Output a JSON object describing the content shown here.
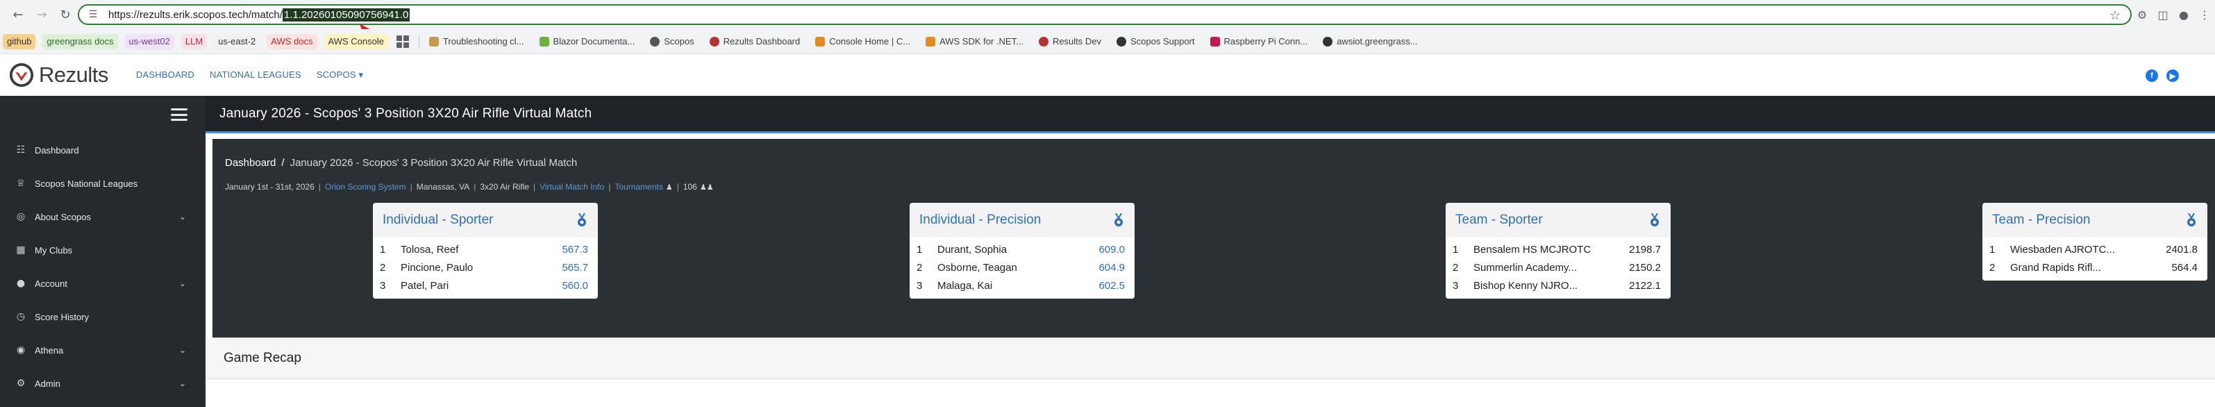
{
  "browser": {
    "url_prefix": "https://rezults.erik.scopos.tech/match/",
    "url_selected": "1.1.20260105090756941.0"
  },
  "bookmarks": {
    "chips": [
      {
        "label": "github",
        "bg": "#f6d18b",
        "fg": "#333333"
      },
      {
        "label": "greengrass docs",
        "bg": "#dff0d8",
        "fg": "#2e6b2e"
      },
      {
        "label": "us-west02",
        "bg": "#efe3f7",
        "fg": "#7a3aa0"
      },
      {
        "label": "LLM",
        "bg": "#fbe1e6",
        "fg": "#b0294a"
      },
      {
        "label": "us-east-2",
        "bg": "#f1f1f1",
        "fg": "#333333"
      },
      {
        "label": "AWS docs",
        "bg": "#fde2e2",
        "fg": "#c62828"
      },
      {
        "label": "AWS Console",
        "bg": "#fff3c4",
        "fg": "#333333"
      }
    ],
    "links": [
      {
        "label": "Troubleshooting cl...",
        "color": "#c79a54"
      },
      {
        "label": "Blazor Documenta...",
        "color": "#6cb33e"
      },
      {
        "label": "Scopos",
        "color": "#555555"
      },
      {
        "label": "Rezults Dashboard",
        "color": "#b5322f"
      },
      {
        "label": "Console Home | C...",
        "color": "#e48b1e"
      },
      {
        "label": "AWS SDK for .NET...",
        "color": "#e48b1e"
      },
      {
        "label": "Results Dev",
        "color": "#b5322f"
      },
      {
        "label": "Scopos Support",
        "color": "#333333"
      },
      {
        "label": "Raspberry Pi Conn...",
        "color": "#c51a4a"
      },
      {
        "label": "awsiot.greengrass...",
        "color": "#333333"
      }
    ]
  },
  "header": {
    "logo_text": "Rezults",
    "nav": [
      "DASHBOARD",
      "NATIONAL LEAGUES",
      "SCOPOS ▾"
    ]
  },
  "sidebar": {
    "items": [
      {
        "label": "Dashboard",
        "icon": "grid-icon",
        "glyph": "☷",
        "chevron": false
      },
      {
        "label": "Scopos National Leagues",
        "icon": "trophy-icon",
        "glyph": "♕",
        "chevron": false
      },
      {
        "label": "About Scopos",
        "icon": "target-icon",
        "glyph": "◎",
        "chevron": true
      },
      {
        "label": "My Clubs",
        "icon": "building-icon",
        "glyph": "▦",
        "chevron": false
      },
      {
        "label": "Account",
        "icon": "user-icon",
        "glyph": "●",
        "chevron": true
      },
      {
        "label": "Score History",
        "icon": "history-icon",
        "glyph": "◷",
        "chevron": false
      },
      {
        "label": "Athena",
        "icon": "athena-icon",
        "glyph": "◉",
        "chevron": true
      },
      {
        "label": "Admin",
        "icon": "gear-icon",
        "glyph": "⚙",
        "chevron": true
      }
    ]
  },
  "page": {
    "title": "January 2026 - Scopos' 3 Position 3X20 Air Rifle Virtual Match",
    "breadcrumb_root": "Dashboard",
    "breadcrumb_separator": "/",
    "breadcrumb_current": "January 2026 - Scopos' 3 Position 3X20 Air Rifle Virtual Match",
    "meta": {
      "dates": "January 1st - 31st, 2026",
      "scoring_system": "Orion Scoring System",
      "location": "Manassas, VA",
      "discipline": "3x20 Air Rifle",
      "virtual_info": "Virtual Match Info",
      "tournaments": "Tournaments",
      "participants": "106"
    }
  },
  "cards": [
    {
      "title": "Individual - Sporter",
      "rows": [
        {
          "rank": "1",
          "name": "Tolosa, Reef",
          "score": "567.3"
        },
        {
          "rank": "2",
          "name": "Pincione, Paulo",
          "score": "565.7"
        },
        {
          "rank": "3",
          "name": "Patel, Pari",
          "score": "560.0"
        }
      ]
    },
    {
      "title": "Individual - Precision",
      "rows": [
        {
          "rank": "1",
          "name": "Durant, Sophia",
          "score": "609.0"
        },
        {
          "rank": "2",
          "name": "Osborne, Teagan",
          "score": "604.9"
        },
        {
          "rank": "3",
          "name": "Malaga, Kai",
          "score": "602.5"
        }
      ]
    },
    {
      "title": "Team - Sporter",
      "rows": [
        {
          "rank": "1",
          "name": "Bensalem HS MCJROTC",
          "score": "2198.7"
        },
        {
          "rank": "2",
          "name": "Summerlin Academy...",
          "score": "2150.2"
        },
        {
          "rank": "3",
          "name": "Bishop Kenny NJRO...",
          "score": "2122.1"
        }
      ]
    },
    {
      "title": "Team - Precision",
      "rows": [
        {
          "rank": "1",
          "name": "Wiesbaden AJROTC...",
          "score": "2401.8"
        },
        {
          "rank": "2",
          "name": "Grand Rapids Rifl...",
          "score": "564.4"
        }
      ]
    }
  ],
  "recap": {
    "title": "Game Recap"
  }
}
